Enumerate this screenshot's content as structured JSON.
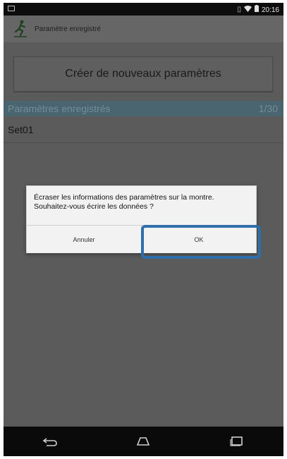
{
  "status_bar": {
    "time": "20:16",
    "icons": [
      "notification-icon",
      "sim-icon",
      "wifi-icon",
      "battery-icon"
    ]
  },
  "action_bar": {
    "title": "Paramètre enregistré",
    "logo_icon": "runner-logo-icon"
  },
  "create_button": {
    "label": "Créer de nouveaux paramètres"
  },
  "section": {
    "title": "Paramètres enregistrés",
    "count": "1/30"
  },
  "list": [
    {
      "label": "Set01"
    }
  ],
  "dialog": {
    "message_line1": "Écraser les informations des paramètres sur la montre.",
    "message_line2": "Souhaitez-vous écrire les données ?",
    "cancel_label": "Annuler",
    "ok_label": "OK"
  },
  "nav_bar": {
    "icons": [
      "back-icon",
      "home-icon",
      "recents-icon"
    ]
  },
  "colors": {
    "highlight": "#2e6eaa",
    "section_header": "#4a6470"
  }
}
